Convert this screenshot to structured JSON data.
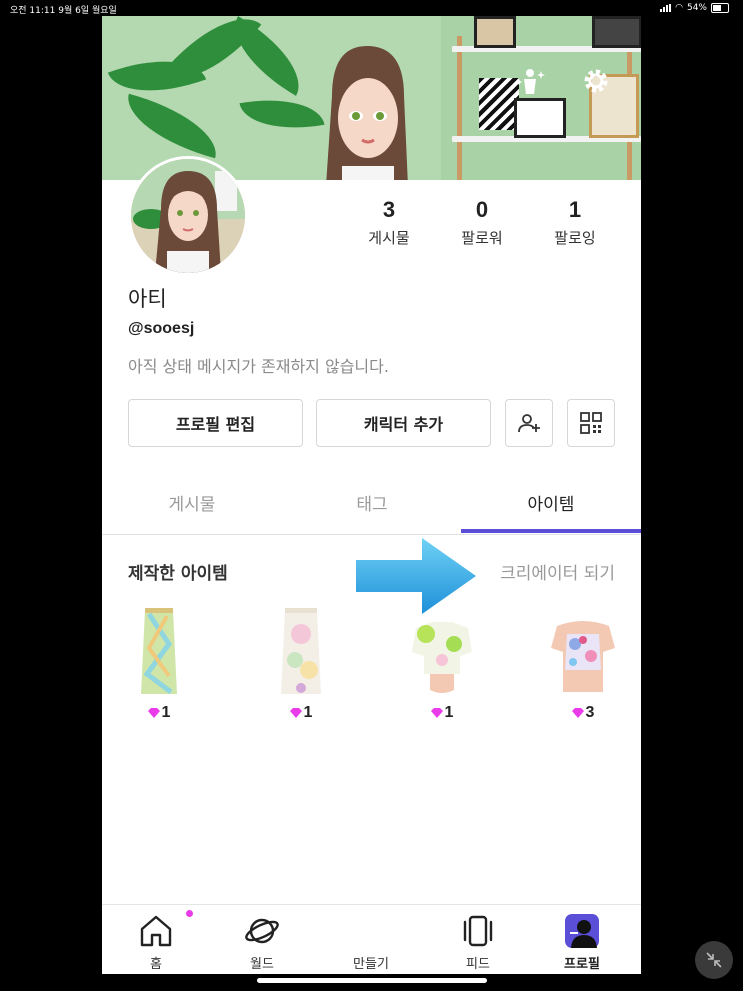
{
  "status_bar": {
    "time_date": "오전 11:11  9월 6일 월요일",
    "battery": "54%"
  },
  "profile": {
    "name": "아티",
    "handle": "@sooesj",
    "status_message": "아직 상태 메시지가 존재하지 않습니다.",
    "stats": [
      {
        "count": "3",
        "label": "게시물"
      },
      {
        "count": "0",
        "label": "팔로워"
      },
      {
        "count": "1",
        "label": "팔로잉"
      }
    ]
  },
  "actions": {
    "edit_profile": "프로필 편집",
    "add_character": "캐릭터 추가"
  },
  "tabs": [
    {
      "label": "게시물",
      "active": false
    },
    {
      "label": "태그",
      "active": false
    },
    {
      "label": "아이템",
      "active": true
    }
  ],
  "items_section": {
    "title": "제작한 아이템",
    "creator_link": "크리에이터 되기",
    "items": [
      {
        "price": "1",
        "kind": "skirt-green"
      },
      {
        "price": "1",
        "kind": "skirt-pastel"
      },
      {
        "price": "1",
        "kind": "top-green"
      },
      {
        "price": "3",
        "kind": "top-floral"
      }
    ]
  },
  "bottom_nav": [
    {
      "label": "홈",
      "icon": "home-icon"
    },
    {
      "label": "월드",
      "icon": "planet-icon"
    },
    {
      "label": "만들기",
      "icon": "create-icon"
    },
    {
      "label": "피드",
      "icon": "feed-icon"
    },
    {
      "label": "프로필",
      "icon": "profile-icon"
    }
  ],
  "colors": {
    "accent": "#5a4fd6",
    "gem": "#e93ce8",
    "banner_green": "#b4d9b1"
  }
}
